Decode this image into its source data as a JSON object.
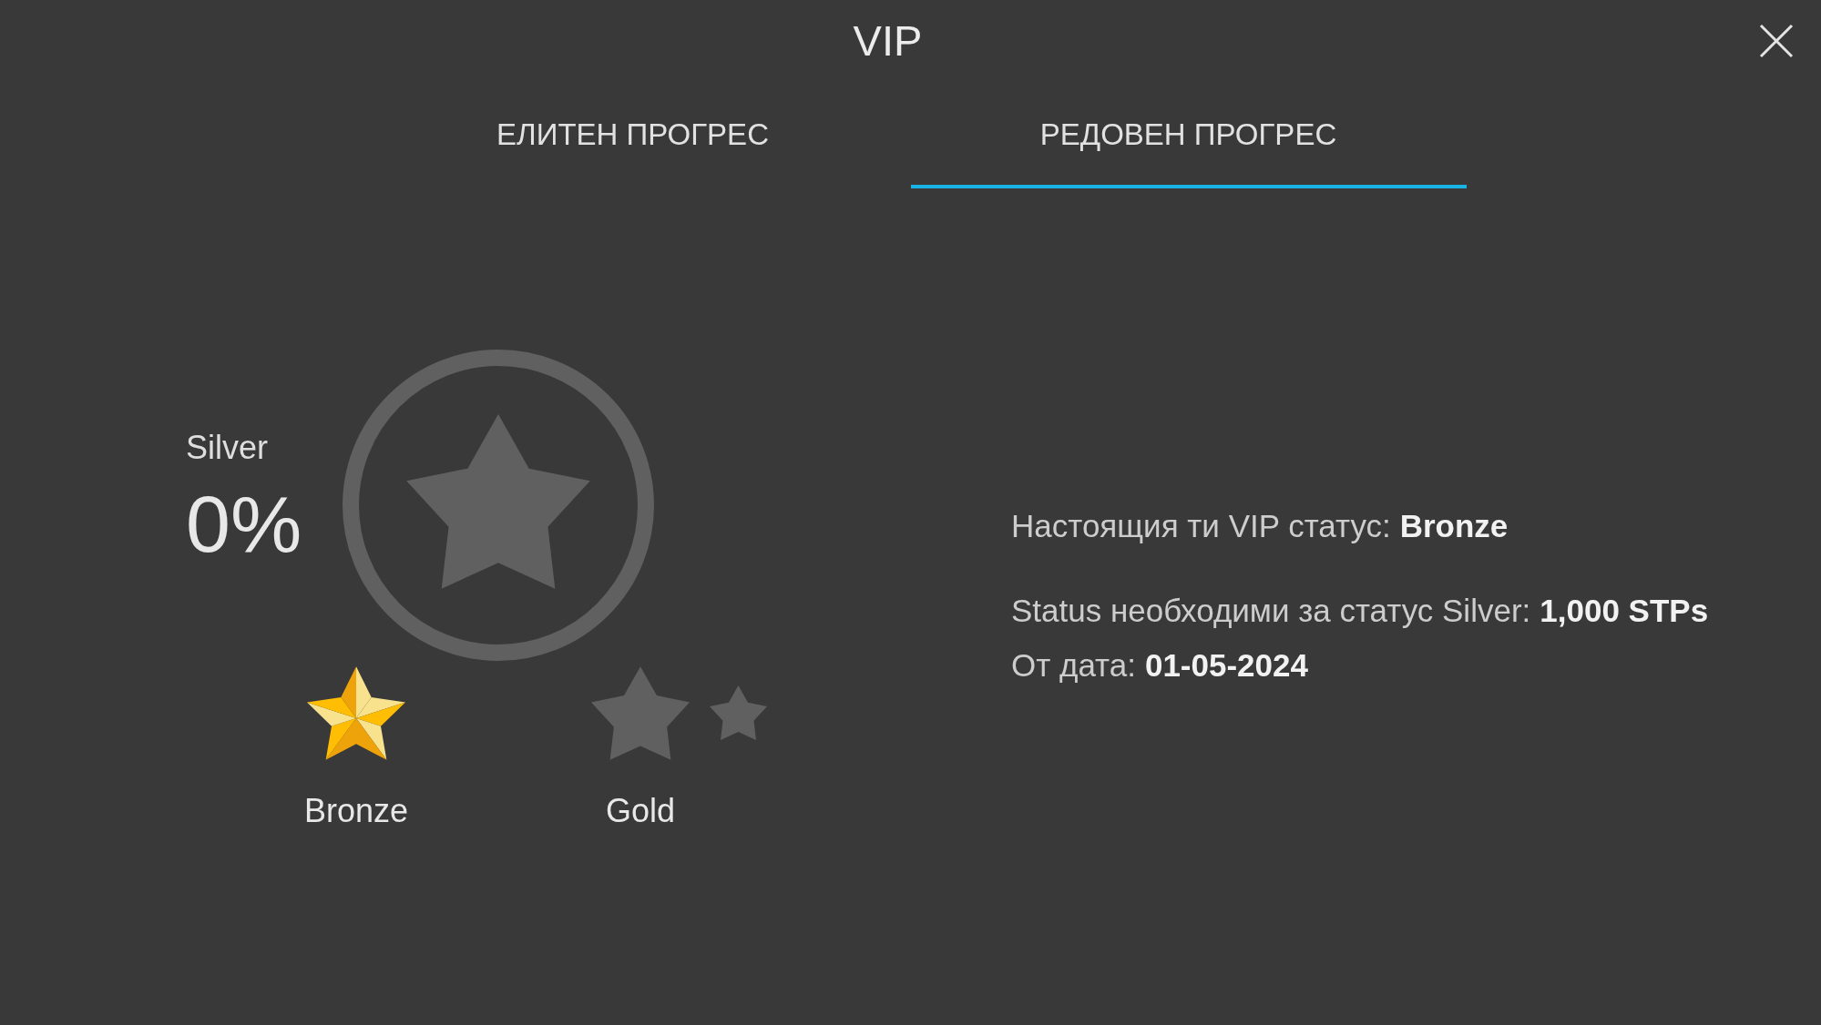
{
  "window": {
    "title": "VIP"
  },
  "tabs": [
    {
      "label": "ЕЛИТЕН ПРОГРЕС",
      "selected": false
    },
    {
      "label": "РЕДОВЕН ПРОГРЕС",
      "selected": true
    }
  ],
  "progress": {
    "target": "Silver",
    "percent": "0%"
  },
  "levels": [
    {
      "name": "Bronze",
      "achieved": true
    },
    {
      "name": "Gold",
      "achieved": false
    }
  ],
  "status": {
    "current": {
      "label": "Настоящия ти VIP статус:",
      "value": "Bronze"
    },
    "details": [
      {
        "label": "Status необходими за статус Silver:",
        "value": "1,000 STPs"
      },
      {
        "label": "От дата:",
        "value": "01-05-2024"
      }
    ]
  }
}
